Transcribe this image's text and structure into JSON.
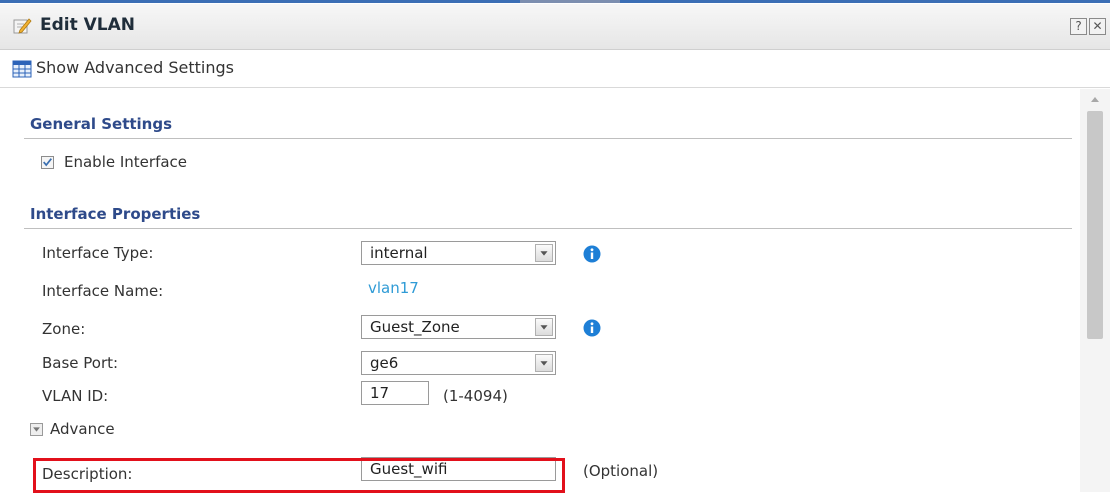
{
  "window": {
    "title": "Edit VLAN",
    "help_label": "?",
    "close_label": "✕"
  },
  "toolbar": {
    "advanced_label": "Show Advanced Settings"
  },
  "general": {
    "title": "General Settings",
    "enable_label": "Enable Interface",
    "enable_checked": true
  },
  "properties": {
    "title": "Interface Properties",
    "interface_type_label": "Interface Type:",
    "interface_type_value": "internal",
    "interface_name_label": "Interface Name:",
    "interface_name_value": "vlan17",
    "zone_label": "Zone:",
    "zone_value": "Guest_Zone",
    "base_port_label": "Base Port:",
    "base_port_value": "ge6",
    "vlan_id_label": "VLAN ID:",
    "vlan_id_value": "17",
    "vlan_id_range": "(1-4094)"
  },
  "advance": {
    "label": "Advance",
    "description_label": "Description:",
    "description_value": "Guest_wifi",
    "description_hint": "(Optional)"
  },
  "colors": {
    "section_title": "#2e4a8a",
    "link": "#2f9bd6",
    "info": "#1e7fd6",
    "highlight": "#e2101b"
  }
}
